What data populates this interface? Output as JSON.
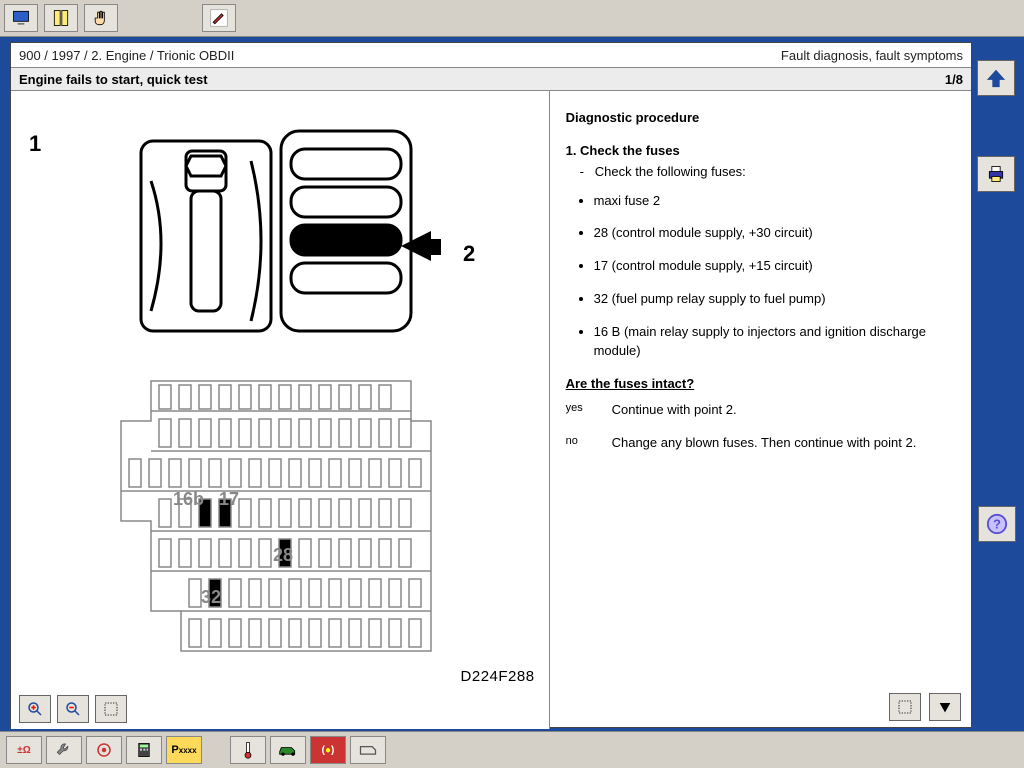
{
  "breadcrumb": "900 / 1997 / 2. Engine / Trionic OBDII",
  "section": "Fault diagnosis, fault symptoms",
  "title": "Engine fails to start, quick test",
  "page": "1/8",
  "proc_heading": "Diagnostic procedure",
  "step1_title": "1. Check the fuses",
  "step1_sub": "Check the following fuses:",
  "fuses": [
    "maxi fuse 2",
    "28 (control module supply, +30 circuit)",
    "17 (control module supply, +15 circuit)",
    "32 (fuel pump relay supply to fuel pump)",
    "16 B (main relay supply to injectors and ignition discharge module)"
  ],
  "question": "Are the fuses intact?",
  "yes_label": "yes",
  "yes_text": "Continue with point 2.",
  "no_label": "no",
  "no_text": "Change any blown fuses. Then continue with point 2.",
  "diagram_code": "D224F288",
  "callout1": "1",
  "callout2": "2",
  "fuse_labels": {
    "a": "16b",
    "b": "17",
    "c": "28",
    "d": "32"
  }
}
